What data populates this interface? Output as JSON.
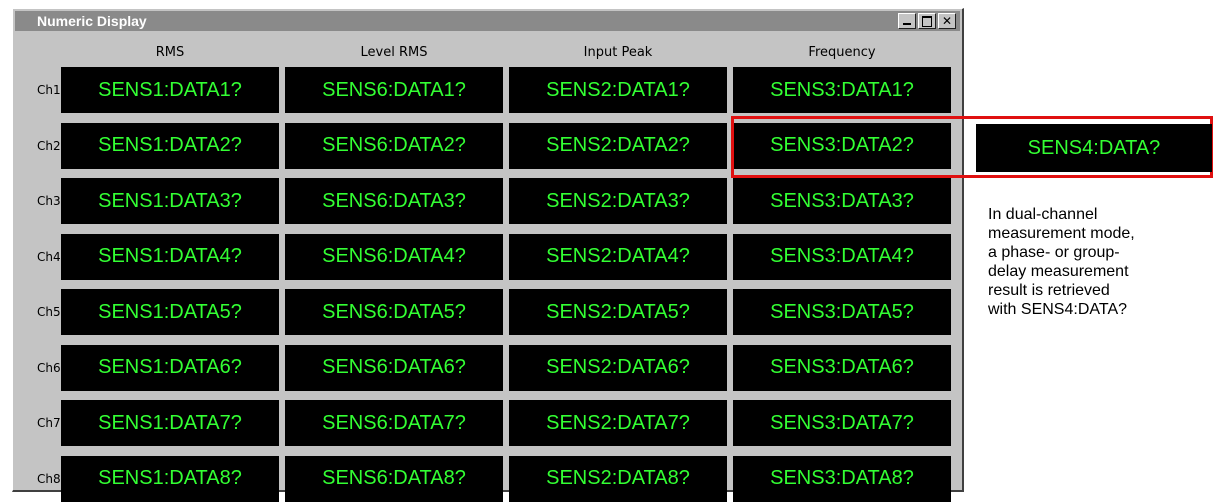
{
  "window": {
    "title": "Numeric Display",
    "buttons": {
      "minimize": "_",
      "maximize": "□",
      "close": "✕"
    }
  },
  "columns": [
    "RMS",
    "Level RMS",
    "Input Peak",
    "Frequency"
  ],
  "rows": [
    {
      "label": "Ch1",
      "cells": [
        "SENS1:DATA1?",
        "SENS6:DATA1?",
        "SENS2:DATA1?",
        "SENS3:DATA1?"
      ]
    },
    {
      "label": "Ch2",
      "cells": [
        "SENS1:DATA2?",
        "SENS6:DATA2?",
        "SENS2:DATA2?",
        "SENS3:DATA2?"
      ]
    },
    {
      "label": "Ch3",
      "cells": [
        "SENS1:DATA3?",
        "SENS6:DATA3?",
        "SENS2:DATA3?",
        "SENS3:DATA3?"
      ]
    },
    {
      "label": "Ch4",
      "cells": [
        "SENS1:DATA4?",
        "SENS6:DATA4?",
        "SENS2:DATA4?",
        "SENS3:DATA4?"
      ]
    },
    {
      "label": "Ch5",
      "cells": [
        "SENS1:DATA5?",
        "SENS6:DATA5?",
        "SENS2:DATA5?",
        "SENS3:DATA5?"
      ]
    },
    {
      "label": "Ch6",
      "cells": [
        "SENS1:DATA6?",
        "SENS6:DATA6?",
        "SENS2:DATA6?",
        "SENS3:DATA6?"
      ]
    },
    {
      "label": "Ch7",
      "cells": [
        "SENS1:DATA7?",
        "SENS6:DATA7?",
        "SENS2:DATA7?",
        "SENS3:DATA7?"
      ]
    },
    {
      "label": "Ch8",
      "cells": [
        "SENS1:DATA8?",
        "SENS6:DATA8?",
        "SENS2:DATA8?",
        "SENS3:DATA8?"
      ]
    }
  ],
  "callout": {
    "cell": "SENS4:DATA?",
    "note": "In dual-channel\nmeasurement mode,\na phase- or group-\ndelay measurement\nresult is retrieved\nwith SENS4:DATA?"
  },
  "colors": {
    "display_bg": "#000000",
    "display_text": "#33ff33",
    "highlight": "#e01010",
    "window_bg": "#c4c4c4",
    "titlebar": "#8a8a8a"
  }
}
